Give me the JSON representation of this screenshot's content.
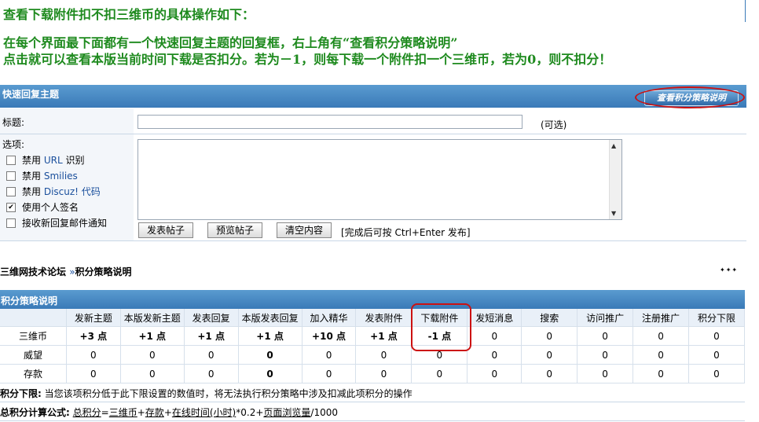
{
  "instructions": {
    "line1": "查看下载附件扣不扣三维币的具体操作如下：",
    "line2": "在每个界面最下面都有一个快速回复主题的回复框，右上角有“查看积分策略说明”",
    "line3": "点击就可以查看本版当前时间下载是否扣分。若为－1，则每下载一个附件扣一个三维币，若为0，则不扣分！"
  },
  "quick_reply": {
    "header": "快速回复主题",
    "policy_button": "查看积分策略说明",
    "title_label": "标题:",
    "title_value": "",
    "optional": "(可选)",
    "options_label": "选项:",
    "options": [
      {
        "prefix": "禁用",
        "keyword": "URL",
        "suffix": "识别",
        "checked": false
      },
      {
        "prefix": "禁用",
        "keyword": "Smilies",
        "suffix": "",
        "checked": false
      },
      {
        "prefix": "禁用",
        "keyword": "Discuz! 代码",
        "suffix": "",
        "checked": false
      },
      {
        "prefix": "使用个人签名",
        "keyword": "",
        "suffix": "",
        "checked": true
      },
      {
        "prefix": "接收新回复邮件通知",
        "keyword": "",
        "suffix": "",
        "checked": false
      }
    ],
    "buttons": {
      "post": "发表帖子",
      "preview": "预览帖子",
      "clear": "清空内容"
    },
    "hint": "[完成后可按 Ctrl+Enter 发布]"
  },
  "breadcrumb": {
    "forum": "三维网技术论坛",
    "sep": "»",
    "page": "积分策略说明",
    "more": "✦✦✦"
  },
  "policy": {
    "header": "积分策略说明",
    "columns": [
      "",
      "发新主题",
      "本版发新主题",
      "发表回复",
      "本版发表回复",
      "加入精华",
      "发表附件",
      "下载附件",
      "发短消息",
      "搜索",
      "访问推广",
      "注册推广",
      "积分下限"
    ],
    "rows": [
      {
        "name": "三维币",
        "values": [
          "+3 点",
          "+1 点",
          "+1 点",
          "+1  点",
          "+10 点",
          "+1 点",
          "-1 点",
          "0",
          "0",
          "0",
          "0",
          "0"
        ]
      },
      {
        "name": "威望",
        "values": [
          "0",
          "0",
          "0",
          "0",
          "0",
          "0",
          "0",
          "0",
          "0",
          "0",
          "0",
          "0"
        ]
      },
      {
        "name": "存款",
        "values": [
          "0",
          "0",
          "0",
          "0",
          "0",
          "0",
          "0",
          "0",
          "0",
          "0",
          "0",
          "0"
        ]
      }
    ],
    "lower_limit_label": "积分下限:",
    "lower_limit_text": "当您该项积分低于此下限设置的数值时，将无法执行积分策略中涉及扣减此项积分的操作",
    "formula_label": "总积分计算公式:",
    "formula": {
      "total": "总积分",
      "eq": "=",
      "coin": "三维币",
      "plus1": "+",
      "deposit": "存款",
      "plus2": "+",
      "online": "在线时间(小时)",
      "mul": "*0.2+",
      "views": "页面浏览量",
      "div": "/1000"
    }
  },
  "colors": {
    "header_blue": "#3a7ab8",
    "green_text": "#1e8a1e",
    "highlight_red": "#cc1111"
  }
}
